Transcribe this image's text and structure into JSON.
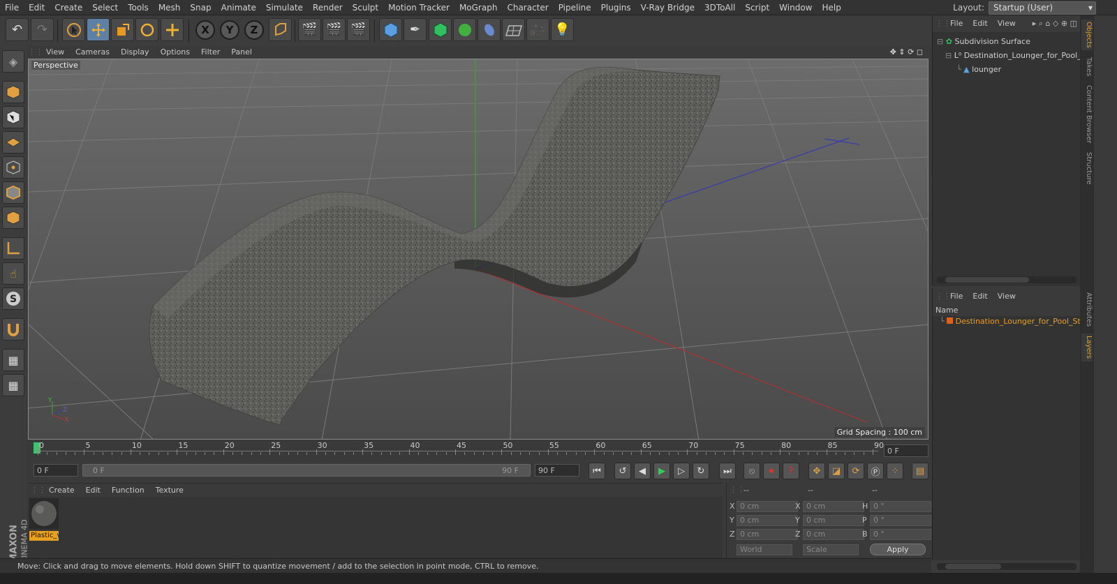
{
  "menu": [
    "File",
    "Edit",
    "Create",
    "Select",
    "Tools",
    "Mesh",
    "Snap",
    "Animate",
    "Simulate",
    "Render",
    "Sculpt",
    "Motion Tracker",
    "MoGraph",
    "Character",
    "Pipeline",
    "Plugins",
    "V-Ray Bridge",
    "3DToAll",
    "Script",
    "Window",
    "Help"
  ],
  "layout": {
    "label": "Layout:",
    "value": "Startup (User)"
  },
  "toolbar": {
    "x": "X",
    "y": "Y",
    "z": "Z"
  },
  "viewport": {
    "menu": [
      "View",
      "Cameras",
      "Display",
      "Options",
      "Filter",
      "Panel"
    ],
    "view_name": "Perspective",
    "grid_spacing": "Grid Spacing : 100 cm",
    "axis_x": "X",
    "axis_y": "Y",
    "axis_z": "Z"
  },
  "timeline": {
    "ticks": [
      "0",
      "5",
      "10",
      "15",
      "20",
      "25",
      "30",
      "35",
      "40",
      "45",
      "50",
      "55",
      "60",
      "65",
      "70",
      "75",
      "80",
      "85",
      "90"
    ],
    "current_frame": "0 F",
    "start_frame": "0 F",
    "range_start": "0 F",
    "range_end": "90 F",
    "end_frame": "90 F"
  },
  "material_manager": {
    "menu": [
      "Create",
      "Edit",
      "Function",
      "Texture"
    ],
    "material_name": "Plastic_v"
  },
  "coordinates": {
    "headers": [
      "--",
      "--",
      "--"
    ],
    "rows": [
      {
        "l1": "X",
        "v1": "0 cm",
        "l2": "X",
        "v2": "0 cm",
        "l3": "H",
        "v3": "0 °"
      },
      {
        "l1": "Y",
        "v1": "0 cm",
        "l2": "Y",
        "v2": "0 cm",
        "l3": "P",
        "v3": "0 °"
      },
      {
        "l1": "Z",
        "v1": "0 cm",
        "l2": "Z",
        "v2": "0 cm",
        "l3": "B",
        "v3": "0 °"
      }
    ],
    "space": "World",
    "mode": "Scale",
    "apply": "Apply"
  },
  "status": "Move: Click and drag to move elements. Hold down SHIFT to quantize movement / add to the selection in point mode, CTRL to remove.",
  "objects_panel": {
    "menu": [
      "File",
      "Edit",
      "View"
    ],
    "items": [
      "Subdivision Surface",
      "Destination_Lounger_for_Pool_S",
      "lounger"
    ]
  },
  "layers_panel": {
    "menu": [
      "File",
      "Edit",
      "View"
    ],
    "column": "Name",
    "items": [
      "Destination_Lounger_for_Pool_St"
    ]
  },
  "side_tabs": [
    "Objects",
    "Takes",
    "Content Browser",
    "Structure",
    "Attributes",
    "Layers"
  ],
  "brand": {
    "maxon": "MAXON",
    "cinema": "CINEMA 4D"
  }
}
